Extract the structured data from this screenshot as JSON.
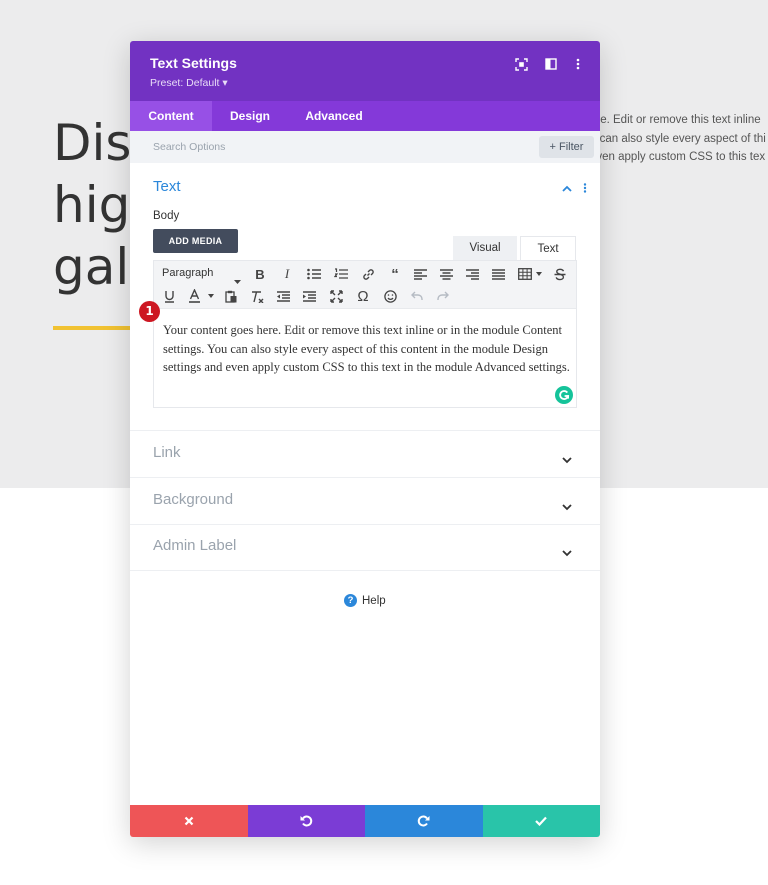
{
  "background": {
    "heading": "Dis\nhig\ngal",
    "paragraph": [
      "ere. Edit or remove this text inline",
      "u can also style every aspect of thi",
      "even apply custom CSS to this tex"
    ]
  },
  "modal": {
    "title": "Text Settings",
    "preset": "Preset: Default ▾",
    "tabs": [
      "Content",
      "Design",
      "Advanced"
    ],
    "active_tab": "Content",
    "search_placeholder": "Search Options",
    "filter_label": "+ Filter",
    "text_section": {
      "title": "Text",
      "body_label": "Body",
      "add_media": "ADD MEDIA",
      "visual_tab": "Visual",
      "text_tab": "Text",
      "paragraph_select": "Paragraph",
      "content": "Your content goes here. Edit or remove this text inline or in the module Content settings. You can also style every aspect of this content in the module Design settings and even apply custom CSS to this text in the module Advanced settings."
    },
    "badge": "1",
    "collapsed_sections": [
      "Link",
      "Background",
      "Admin Label"
    ],
    "help_label": "Help"
  },
  "colors": {
    "header": "#7232c2",
    "tabs": "#8439d9",
    "accent_blue": "#2b87da",
    "cancel": "#ee5557",
    "undo": "#7b3cd5",
    "redo": "#2b87da",
    "save": "#29c4a9",
    "underline": "#f1c232"
  }
}
